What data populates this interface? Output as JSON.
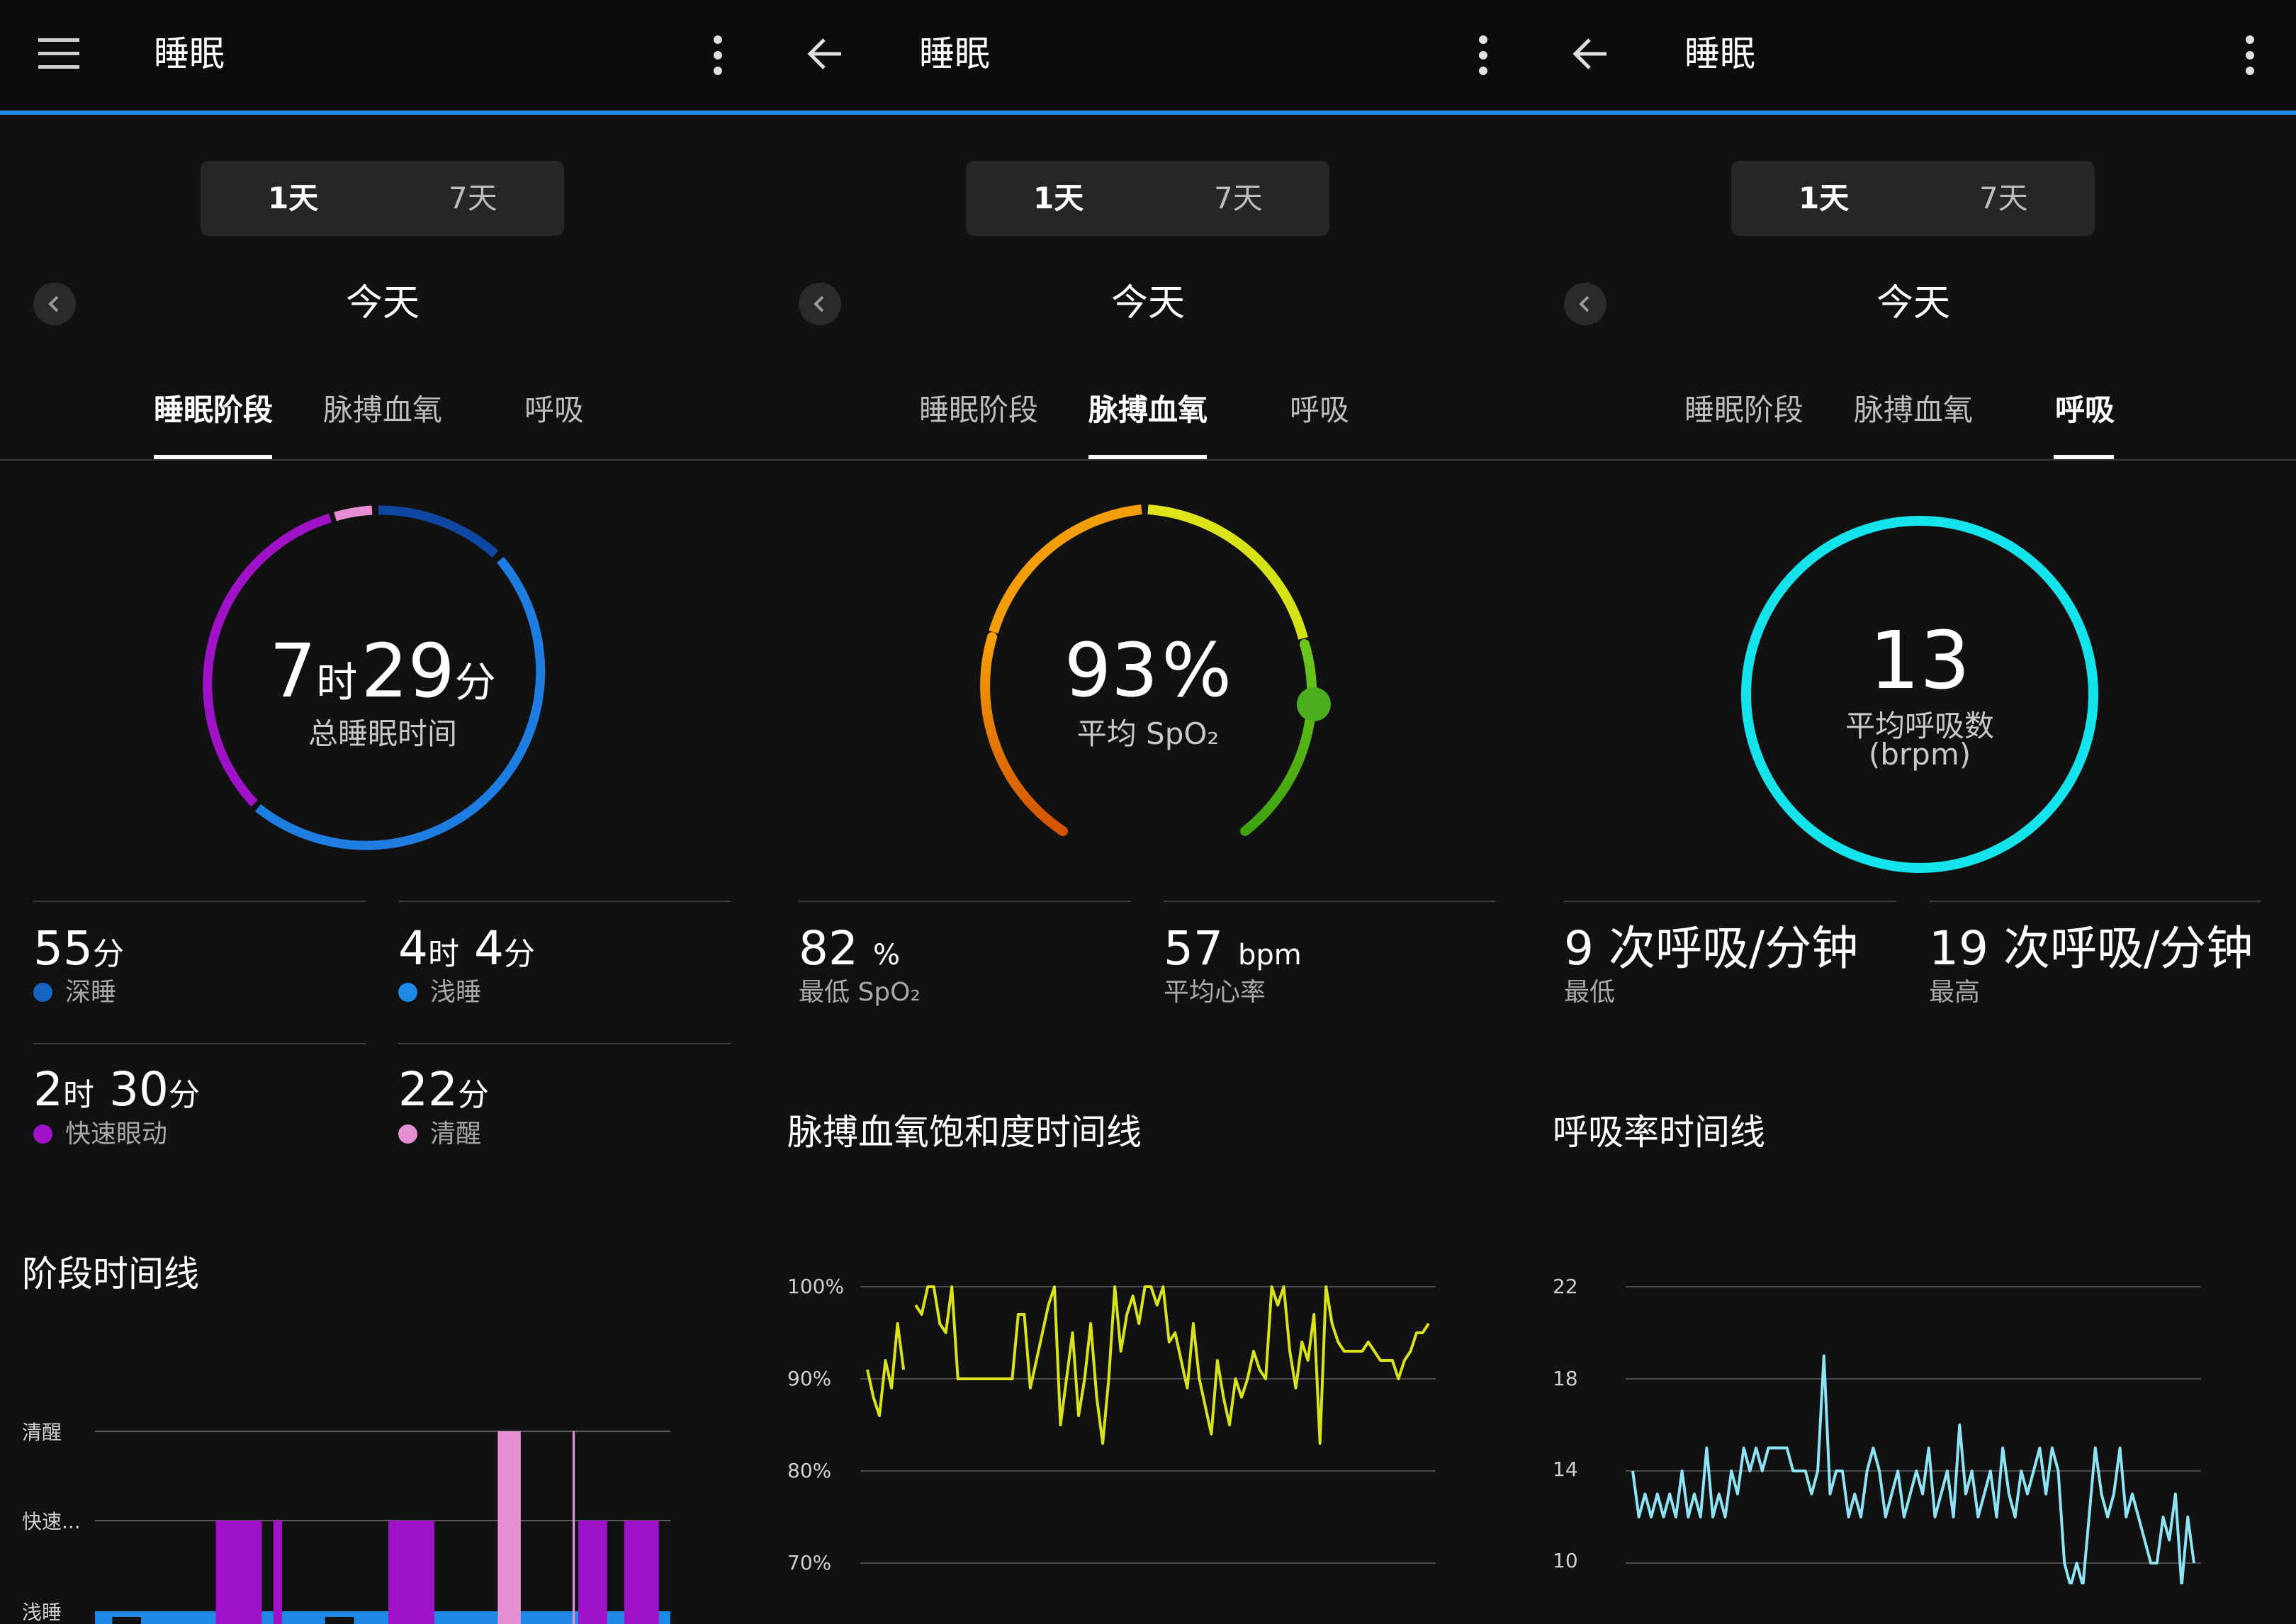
{
  "divider_color": "#1e88e5",
  "panels": [
    {
      "title": "睡眠",
      "nav_icon": "hamburger-menu-icon",
      "more_icon": "vertical-dots-more-icon",
      "range_tabs": [
        "1天",
        "7天"
      ],
      "date": "今天",
      "tabs": [
        "睡眠阶段",
        "脉搏血氧",
        "呼吸"
      ],
      "active_tab": 0,
      "ring": {
        "hours": "7",
        "hours_unit": "时",
        "minutes": "29",
        "minutes_unit": "分",
        "label": "总睡眠时间",
        "segments_minutes": {
          "deep": 55,
          "light": 244,
          "rem": 150,
          "awake": 22
        }
      },
      "stats": [
        {
          "value": "55",
          "unit": "分",
          "label": "深睡",
          "color": "#1565c0"
        },
        {
          "value": "4",
          "unit": "时",
          "value2": "4",
          "unit2": "分",
          "label": "浅睡",
          "color": "#1e88e5"
        },
        {
          "value": "2",
          "unit": "时",
          "value2": "30",
          "unit2": "分",
          "label": "快速眼动",
          "color": "#a012c8"
        },
        {
          "value": "22",
          "unit": "分",
          "label": "清醒",
          "color": "#e58fd3"
        }
      ],
      "section_title": "阶段时间线",
      "timeline": {
        "levels": [
          "清醒",
          "快速...",
          "浅睡"
        ],
        "colors": {
          "awake": "#e58fd3",
          "rem": "#a012c8",
          "light": "#1e88e5",
          "gap": "#111111"
        }
      }
    },
    {
      "title": "睡眠",
      "nav_icon": "back-arrow-icon",
      "more_icon": "vertical-dots-more-icon",
      "range_tabs": [
        "1天",
        "7天"
      ],
      "date": "今天",
      "tabs": [
        "睡眠阶段",
        "脉搏血氧",
        "呼吸"
      ],
      "active_tab": 1,
      "gauge": {
        "value": "93",
        "unit": "%",
        "label": "平均 SpO₂",
        "value_num": 93
      },
      "stats": [
        {
          "value": "82",
          "unit": "%",
          "label": "最低 SpO₂"
        },
        {
          "value": "57",
          "unit": "bpm",
          "label": "平均心率"
        }
      ],
      "section_title": "脉搏血氧饱和度时间线"
    },
    {
      "title": "睡眠",
      "nav_icon": "back-arrow-icon",
      "more_icon": "vertical-dots-more-icon",
      "range_tabs": [
        "1天",
        "7天"
      ],
      "date": "今天",
      "tabs": [
        "睡眠阶段",
        "脉搏血氧",
        "呼吸"
      ],
      "active_tab": 2,
      "ring": {
        "value": "13",
        "label": "平均呼吸数",
        "unit_label": "(brpm)",
        "color": "#16e4ec"
      },
      "stats": [
        {
          "value": "9",
          "unit": "次呼吸/分钟",
          "label": "最低"
        },
        {
          "value": "19",
          "unit": "次呼吸/分钟",
          "label": "最高"
        }
      ],
      "section_title": "呼吸率时间线"
    }
  ],
  "chart_data": [
    {
      "type": "bar",
      "title": "阶段时间线",
      "y_categories": [
        "清醒",
        "快速...",
        "浅睡"
      ],
      "x_range": [
        0,
        100
      ],
      "segments": [
        {
          "stage": "light",
          "start": 0,
          "end": 100
        },
        {
          "stage": "rem",
          "start": 21,
          "end": 29
        },
        {
          "stage": "rem",
          "start": 31,
          "end": 32.5
        },
        {
          "stage": "rem",
          "start": 51,
          "end": 52
        },
        {
          "stage": "rem",
          "start": 52,
          "end": 59
        },
        {
          "stage": "awake",
          "start": 70,
          "end": 74
        },
        {
          "stage": "awake",
          "start": 83,
          "end": 83.4
        },
        {
          "stage": "rem",
          "start": 84,
          "end": 89
        },
        {
          "stage": "rem",
          "start": 92,
          "end": 98
        }
      ],
      "gaps": [
        {
          "start": 3,
          "end": 8
        },
        {
          "start": 40,
          "end": 45
        }
      ]
    },
    {
      "type": "line",
      "title": "脉搏血氧饱和度时间线",
      "ylim": [
        70,
        100
      ],
      "yticks": [
        "100%",
        "90%",
        "80%",
        "70%"
      ],
      "ytick_values": [
        100,
        90,
        80,
        70
      ],
      "color": "#d9e21b",
      "values": [
        91,
        88,
        86,
        92,
        89,
        96,
        91,
        null,
        98,
        97,
        100,
        100,
        96,
        95,
        100,
        90,
        90,
        90,
        90,
        90,
        90,
        90,
        90,
        90,
        90,
        97,
        97,
        89,
        92,
        95,
        98,
        100,
        85,
        90,
        95,
        86,
        90,
        96,
        88,
        83,
        90,
        100,
        93,
        97,
        99,
        96,
        100,
        100,
        98,
        100,
        94,
        95,
        92,
        89,
        96,
        90,
        87,
        84,
        92,
        88,
        85,
        90,
        88,
        90,
        93,
        91,
        90,
        100,
        98,
        100,
        93,
        89,
        94,
        92,
        97,
        83,
        100,
        96,
        94,
        93,
        93,
        93,
        93,
        94,
        93,
        92,
        92,
        92,
        90,
        92,
        93,
        95,
        95,
        96
      ]
    },
    {
      "type": "line",
      "title": "呼吸率时间线",
      "ylim": [
        9,
        22
      ],
      "yticks": [
        "22",
        "18",
        "14",
        "10"
      ],
      "ytick_values": [
        22,
        18,
        14,
        10
      ],
      "color": "#8ee3f5",
      "values": [
        14,
        12,
        13,
        12,
        13,
        12,
        13,
        12,
        14,
        12,
        13,
        12,
        15,
        12,
        13,
        12,
        14,
        13,
        15,
        14,
        15,
        14,
        15,
        15,
        15,
        15,
        14,
        14,
        14,
        13,
        14,
        19,
        13,
        14,
        14,
        12,
        13,
        12,
        14,
        15,
        14,
        12,
        13,
        14,
        12,
        13,
        14,
        13,
        15,
        12,
        13,
        14,
        12,
        16,
        13,
        14,
        12,
        13,
        14,
        12,
        15,
        13,
        12,
        14,
        13,
        14,
        15,
        13,
        15,
        14,
        10,
        9,
        10,
        9,
        12,
        15,
        13,
        12,
        13,
        15,
        12,
        13,
        12,
        11,
        10,
        10,
        12,
        11,
        13,
        9,
        12,
        10
      ]
    }
  ]
}
